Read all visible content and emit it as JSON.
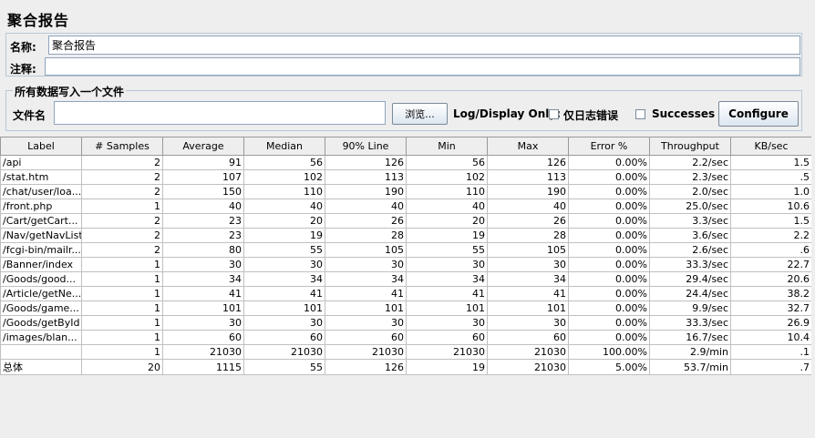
{
  "panel": {
    "title": "聚合报告",
    "name_label": "名称:",
    "name_value": "聚合报告",
    "comment_label": "注释:",
    "comment_value": ""
  },
  "file_section": {
    "title": "所有数据写入一个文件",
    "filename_label": "文件名",
    "filename_value": "",
    "browse_label": "浏览...",
    "log_display_label": "Log/Display Only:",
    "errors_only_label": "仅日志错误",
    "successes_label": "Successes",
    "configure_label": "Configure"
  },
  "table": {
    "columns": [
      "Label",
      "# Samples",
      "Average",
      "Median",
      "90% Line",
      "Min",
      "Max",
      "Error %",
      "Throughput",
      "KB/sec"
    ],
    "rows": [
      [
        "/api",
        "2",
        "91",
        "56",
        "126",
        "56",
        "126",
        "0.00%",
        "2.2/sec",
        "1.5"
      ],
      [
        "/stat.htm",
        "2",
        "107",
        "102",
        "113",
        "102",
        "113",
        "0.00%",
        "2.3/sec",
        ".5"
      ],
      [
        "/chat/user/loa...",
        "2",
        "150",
        "110",
        "190",
        "110",
        "190",
        "0.00%",
        "2.0/sec",
        "1.0"
      ],
      [
        "/front.php",
        "1",
        "40",
        "40",
        "40",
        "40",
        "40",
        "0.00%",
        "25.0/sec",
        "10.6"
      ],
      [
        "/Cart/getCart...",
        "2",
        "23",
        "20",
        "26",
        "20",
        "26",
        "0.00%",
        "3.3/sec",
        "1.5"
      ],
      [
        "/Nav/getNavList",
        "2",
        "23",
        "19",
        "28",
        "19",
        "28",
        "0.00%",
        "3.6/sec",
        "2.2"
      ],
      [
        "/fcgi-bin/mailr...",
        "2",
        "80",
        "55",
        "105",
        "55",
        "105",
        "0.00%",
        "2.6/sec",
        ".6"
      ],
      [
        "/Banner/index",
        "1",
        "30",
        "30",
        "30",
        "30",
        "30",
        "0.00%",
        "33.3/sec",
        "22.7"
      ],
      [
        "/Goods/good...",
        "1",
        "34",
        "34",
        "34",
        "34",
        "34",
        "0.00%",
        "29.4/sec",
        "20.6"
      ],
      [
        "/Article/getNe...",
        "1",
        "41",
        "41",
        "41",
        "41",
        "41",
        "0.00%",
        "24.4/sec",
        "38.2"
      ],
      [
        "/Goods/game...",
        "1",
        "101",
        "101",
        "101",
        "101",
        "101",
        "0.00%",
        "9.9/sec",
        "32.7"
      ],
      [
        "/Goods/getById",
        "1",
        "30",
        "30",
        "30",
        "30",
        "30",
        "0.00%",
        "33.3/sec",
        "26.9"
      ],
      [
        "/images/blan...",
        "1",
        "60",
        "60",
        "60",
        "60",
        "60",
        "0.00%",
        "16.7/sec",
        "10.4"
      ],
      [
        "",
        "1",
        "21030",
        "21030",
        "21030",
        "21030",
        "21030",
        "100.00%",
        "2.9/min",
        ".1"
      ],
      [
        "总体",
        "20",
        "1115",
        "55",
        "126",
        "19",
        "21030",
        "5.00%",
        "53.7/min",
        ".7"
      ]
    ]
  }
}
